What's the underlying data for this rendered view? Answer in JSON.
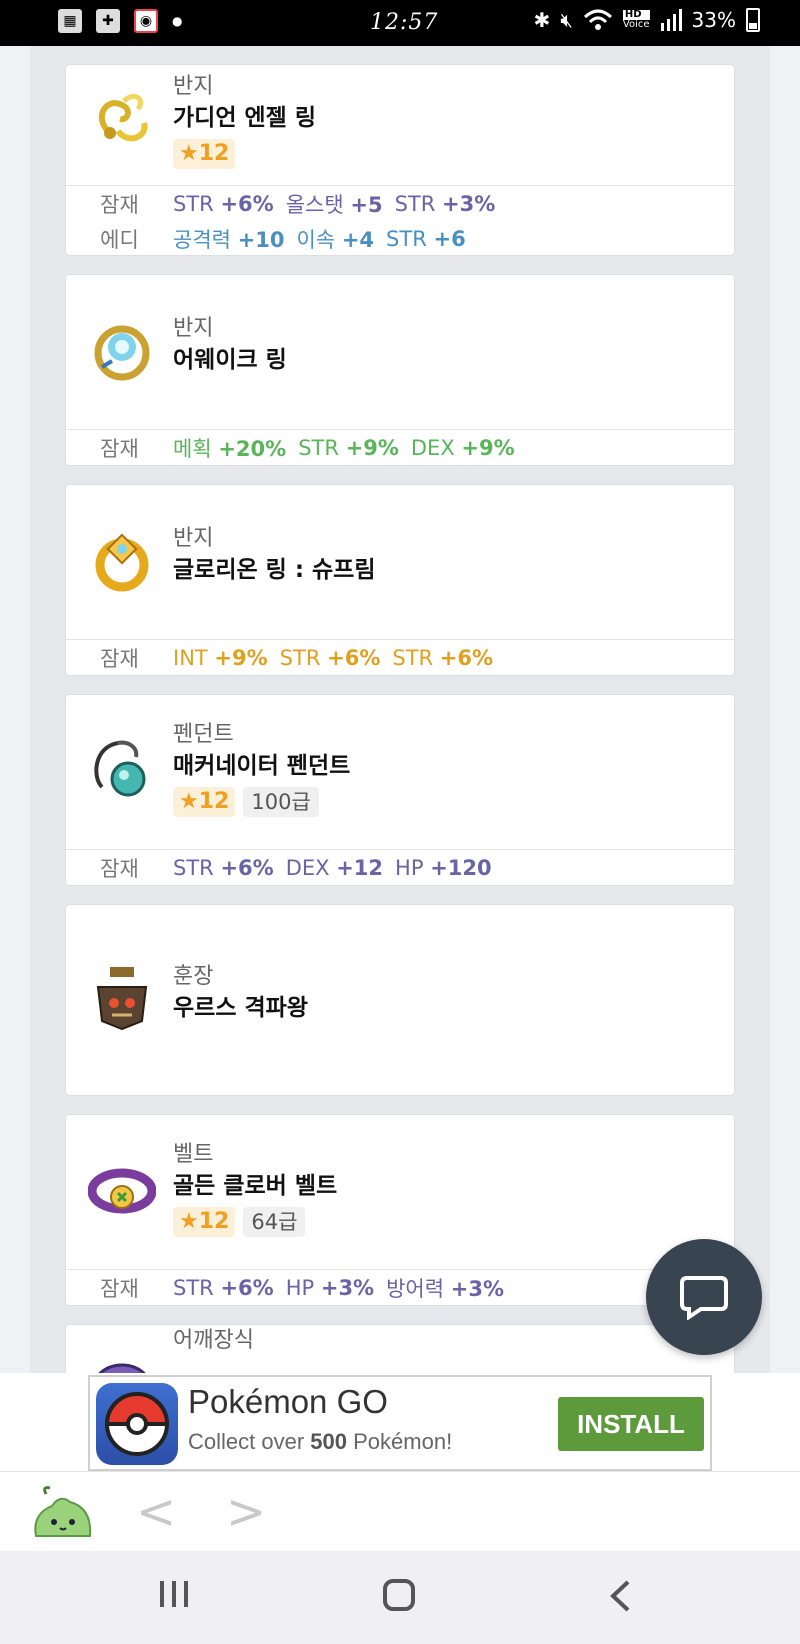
{
  "status_bar": {
    "time": "12:57",
    "battery": "33%",
    "hd_label": "HD",
    "voice_label": "Voice"
  },
  "colors": {
    "purple": "#6a63a5",
    "blue": "#4a8fc4",
    "green": "#5ab55a",
    "gold": "#e0a020",
    "install": "#5d9a3c"
  },
  "items": [
    {
      "category": "반지",
      "name": "가디언 엔젤 링",
      "star": "★12",
      "options": [
        {
          "label": "잠재",
          "color": "purple",
          "stats": [
            {
              "k": "STR",
              "v": "+6%"
            },
            {
              "k": "올스탯",
              "v": "+5"
            },
            {
              "k": "STR",
              "v": "+3%"
            }
          ]
        },
        {
          "label": "에디",
          "color": "blue",
          "stats": [
            {
              "k": "공격력",
              "v": "+10"
            },
            {
              "k": "이속",
              "v": "+4"
            },
            {
              "k": "STR",
              "v": "+6"
            }
          ]
        }
      ]
    },
    {
      "category": "반지",
      "name": "어웨이크 링",
      "options": [
        {
          "label": "잠재",
          "color": "green",
          "stats": [
            {
              "k": "메획",
              "v": "+20%"
            },
            {
              "k": "STR",
              "v": "+9%"
            },
            {
              "k": "DEX",
              "v": "+9%"
            }
          ]
        }
      ]
    },
    {
      "category": "반지",
      "name": "글로리온 링 : 슈프림",
      "options": [
        {
          "label": "잠재",
          "color": "gold",
          "stats": [
            {
              "k": "INT",
              "v": "+9%"
            },
            {
              "k": "STR",
              "v": "+6%"
            },
            {
              "k": "STR",
              "v": "+6%"
            }
          ]
        }
      ]
    },
    {
      "category": "펜던트",
      "name": "매커네이터 펜던트",
      "star": "★12",
      "level": "100급",
      "options": [
        {
          "label": "잠재",
          "color": "purple",
          "stats": [
            {
              "k": "STR",
              "v": "+6%"
            },
            {
              "k": "DEX",
              "v": "+12"
            },
            {
              "k": "HP",
              "v": "+120"
            }
          ]
        }
      ]
    },
    {
      "category": "훈장",
      "name": "우르스 격파왕"
    },
    {
      "category": "벨트",
      "name": "골든 클로버 벨트",
      "star": "★12",
      "level": "64급",
      "options": [
        {
          "label": "잠재",
          "color": "purple",
          "stats": [
            {
              "k": "STR",
              "v": "+6%"
            },
            {
              "k": "HP",
              "v": "+3%"
            },
            {
              "k": "방어력",
              "v": "+3%"
            }
          ]
        }
      ]
    },
    {
      "category": "어깨장식"
    }
  ],
  "ad": {
    "title": "Pokémon GO",
    "subtitle_prefix": "Collect over",
    "subtitle_number": "500",
    "subtitle_suffix": "Pokémon!",
    "button": "INSTALL"
  },
  "browser_bar": {
    "back": "<",
    "forward": ">"
  }
}
